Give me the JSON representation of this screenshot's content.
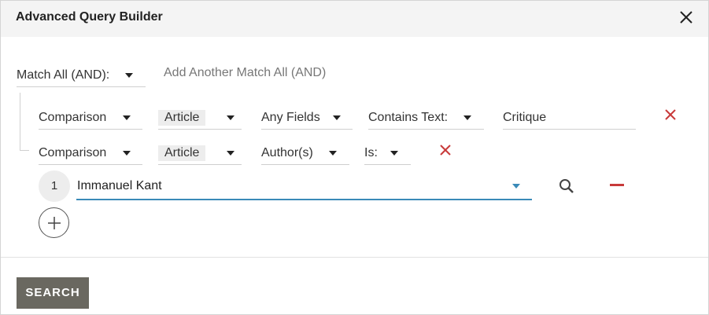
{
  "dialog": {
    "title": "Advanced Query Builder",
    "close_icon": "close-icon"
  },
  "match_group": {
    "selector_label": "Match All (AND):",
    "add_another_label": "Add Another Match All (AND)"
  },
  "rows": [
    {
      "type_label": "Comparison",
      "scope_label": "Article",
      "field_label": "Any Fields",
      "operator_label": "Contains Text:",
      "value": "Critique"
    },
    {
      "type_label": "Comparison",
      "scope_label": "Article",
      "field_label": "Author(s)",
      "operator_label": "Is:"
    }
  ],
  "author_value": {
    "index": "1",
    "value": "Immanuel Kant"
  },
  "footer": {
    "search_label": "SEARCH"
  },
  "colors": {
    "accent": "#3a8ab8",
    "remove": "#c83a3a",
    "button_bg": "#6a6860",
    "header_bg": "#f4f4f4"
  }
}
